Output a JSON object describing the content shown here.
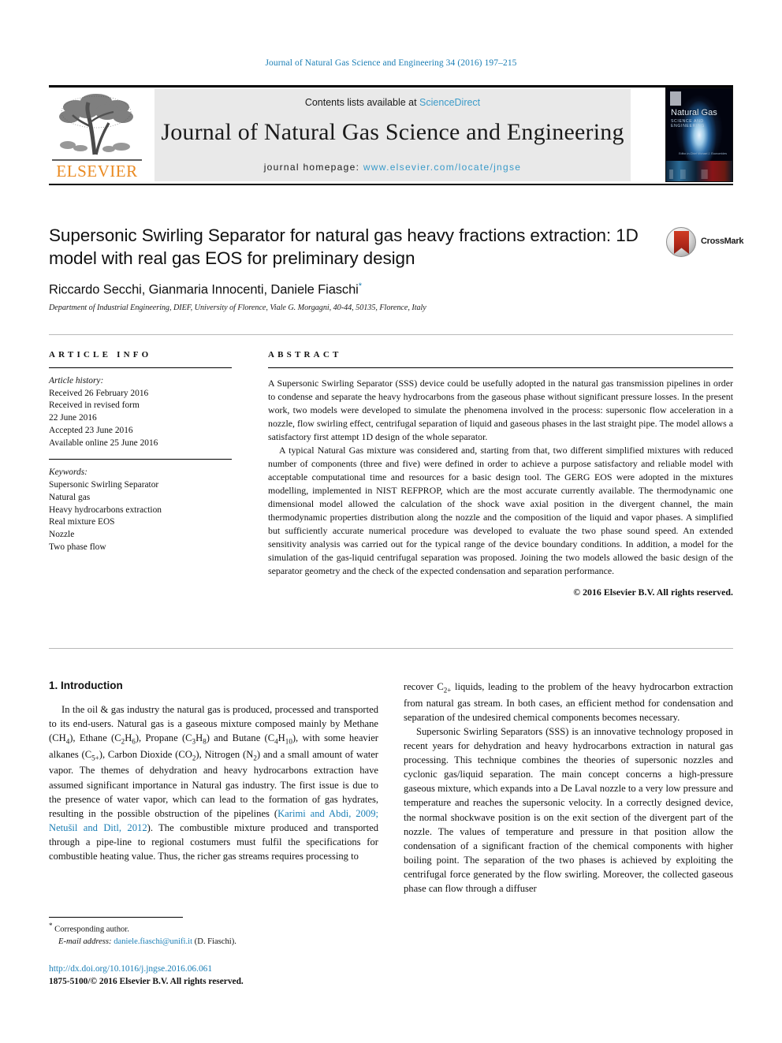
{
  "running_head": "Journal of Natural Gas Science and Engineering 34 (2016) 197–215",
  "masthead": {
    "contents_prefix": "Contents lists available at ",
    "sciencedirect": "ScienceDirect",
    "journal_title": "Journal of Natural Gas Science and Engineering",
    "homepage_label": "journal homepage: ",
    "homepage_url": "www.elsevier.com/locate/jngse",
    "publisher": "ELSEVIER",
    "cover": {
      "title": "Natural Gas",
      "subtitle": "SCIENCE AND ENGINEERING",
      "editors": "Editor-in-Chief\nMichael J. Economides"
    },
    "accent_link_color": "#3b9bc9",
    "publisher_color": "#ea8a21"
  },
  "article": {
    "title": "Supersonic Swirling Separator for natural gas heavy fractions extraction: 1D model with real gas EOS for preliminary design",
    "authors": "Riccardo Secchi, Gianmaria Innocenti, Daniele Fiaschi",
    "corresponding_marker": "*",
    "affiliation": "Department of Industrial Engineering, DIEF, University of Florence, Viale G. Morgagni, 40-44, 50135, Florence, Italy",
    "crossmark_label": "CrossMark"
  },
  "article_info": {
    "heading": "ARTICLE INFO",
    "history_label": "Article history:",
    "history": [
      "Received 26 February 2016",
      "Received in revised form",
      "22 June 2016",
      "Accepted 23 June 2016",
      "Available online 25 June 2016"
    ],
    "keywords_label": "Keywords:",
    "keywords": [
      "Supersonic Swirling Separator",
      "Natural gas",
      "Heavy hydrocarbons extraction",
      "Real mixture EOS",
      "Nozzle",
      "Two phase flow"
    ]
  },
  "abstract": {
    "heading": "ABSTRACT",
    "paragraph1": "A Supersonic Swirling Separator (SSS) device could be usefully adopted in the natural gas transmission pipelines in order to condense and separate the heavy hydrocarbons from the gaseous phase without significant pressure losses. In the present work, two models were developed to simulate the phenomena involved in the process: supersonic flow acceleration in a nozzle, flow swirling effect, centrifugal separation of liquid and gaseous phases in the last straight pipe. The model allows a satisfactory first attempt 1D design of the whole separator.",
    "paragraph2": "A typical Natural Gas mixture was considered and, starting from that, two different simplified mixtures with reduced number of components (three and five) were defined in order to achieve a purpose satisfactory and reliable model with acceptable computational time and resources for a basic design tool. The GERG EOS were adopted in the mixtures modelling, implemented in NIST REFPROP, which are the most accurate currently available. The thermodynamic one dimensional model allowed the calculation of the shock wave axial position in the divergent channel, the main thermodynamic properties distribution along the nozzle and the composition of the liquid and vapor phases. A simplified but sufficiently accurate numerical procedure was developed to evaluate the two phase sound speed. An extended sensitivity analysis was carried out for the typical range of the device boundary conditions. In addition, a model for the simulation of the gas-liquid centrifugal separation was proposed. Joining the two models allowed the basic design of the separator geometry and the check of the expected condensation and separation performance.",
    "copyright": "© 2016 Elsevier B.V. All rights reserved."
  },
  "introduction": {
    "heading": "1. Introduction",
    "left_paragraph": "In the oil & gas industry the natural gas is produced, processed and transported to its end-users. Natural gas is a gaseous mixture composed mainly by Methane (CH4), Ethane (C2H6), Propane (C3H8) and Butane (C4H10), with some heavier alkanes (C5+), Carbon Dioxide (CO2), Nitrogen (N2) and a small amount of water vapor. The themes of dehydration and heavy hydrocarbons extraction have assumed significant importance in Natural gas industry. The first issue is due to the presence of water vapor, which can lead to the formation of gas hydrates, resulting in the possible obstruction of the pipelines (",
    "citation": "Karimi and Abdi, 2009; Netušil and Ditl, 2012",
    "left_paragraph_cont": "). The combustible mixture produced and transported through a pipe-line to regional costumers must fulfil the specifications for combustible heating value. Thus, the richer gas streams requires processing to",
    "right_paragraph1": "recover C2+ liquids, leading to the problem of the heavy hydrocarbon extraction from natural gas stream. In both cases, an efficient method for condensation and separation of the undesired chemical components becomes necessary.",
    "right_paragraph2": "Supersonic Swirling Separators (SSS) is an innovative technology proposed in recent years for dehydration and heavy hydrocarbons extraction in natural gas processing. This technique combines the theories of supersonic nozzles and cyclonic gas/liquid separation. The main concept concerns a high-pressure gaseous mixture, which expands into a De Laval nozzle to a very low pressure and temperature and reaches the supersonic velocity. In a correctly designed device, the normal shockwave position is on the exit section of the divergent part of the nozzle. The values of temperature and pressure in that position allow the condensation of a significant fraction of the chemical components with higher boiling point. The separation of the two phases is achieved by exploiting the centrifugal force generated by the flow swirling. Moreover, the collected gaseous phase can flow through a diffuser"
  },
  "footer": {
    "corresponding_marker": "*",
    "corresponding_label": "Corresponding author.",
    "email_label": "E-mail address:",
    "email": "daniele.fiaschi@unifi.it",
    "email_owner": "(D. Fiaschi).",
    "doi": "http://dx.doi.org/10.1016/j.jngse.2016.06.061",
    "issn_line": "1875-5100/© 2016 Elsevier B.V. All rights reserved."
  }
}
